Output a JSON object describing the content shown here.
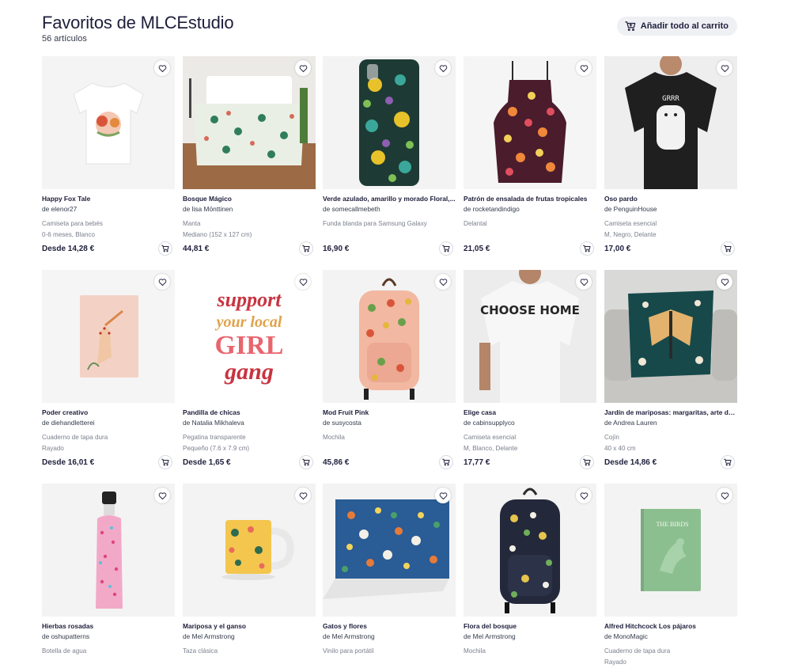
{
  "page": {
    "title": "Favoritos de MLCEstudio",
    "count": "56 artículos",
    "add_all_label": "Añadir todo al carrito",
    "add_all_icon": "cart-icon"
  },
  "products": [
    {
      "name": "Happy Fox Tale",
      "artist": "de elenor27",
      "type": "Camiseta para bebés",
      "variant": "0-6 meses, Blanco",
      "price": "Desde 14,28 €"
    },
    {
      "name": "Bosque Mágico",
      "artist": "de lisa Mönttinen",
      "type": "Manta",
      "variant": "Mediano (152 x 127 cm)",
      "price": "44,81 €"
    },
    {
      "name": "Verde azulado, amarillo y morado Floral,...",
      "artist": "de somecallmebeth",
      "type": "Funda blanda para Samsung Galaxy",
      "variant": "",
      "price": "16,90 €"
    },
    {
      "name": "Patrón de ensalada de frutas tropicales",
      "artist": "de rocketandindigo",
      "type": "Delantal",
      "variant": "",
      "price": "21,05 €"
    },
    {
      "name": "Oso pardo",
      "artist": "de PenguinHouse",
      "type": "Camiseta esencial",
      "variant": "M, Negro, Delante",
      "price": "17,00 €"
    },
    {
      "name": "Poder creativo",
      "artist": "de diehandletterei",
      "type": "Cuaderno de tapa dura",
      "variant": "Rayado",
      "price": "Desde 16,01 €"
    },
    {
      "name": "Pandilla de chicas",
      "artist": "de Natalia Mikhaleva",
      "type": "Pegatina transparente",
      "variant": "Pequeño (7.6 x 7.9 cm)",
      "price": "Desde 1,65 €"
    },
    {
      "name": "Mod Fruit Pink",
      "artist": "de susycosta",
      "type": "Mochila",
      "variant": "",
      "price": "45,86 €"
    },
    {
      "name": "Elige casa",
      "artist": "de cabinsupplyco",
      "type": "Camiseta esencial",
      "variant": "M, Blanco, Delante",
      "price": "17,77 €"
    },
    {
      "name": "Jardín de mariposas: margaritas, arte de...",
      "artist": "de Andrea Lauren",
      "type": "Cojín",
      "variant": "40 x 40 cm",
      "price": "Desde 14,86 €"
    },
    {
      "name": "Hierbas rosadas",
      "artist": "de oshupatterns",
      "type": "Botella de agua",
      "variant": "",
      "price": ""
    },
    {
      "name": "Mariposa y el ganso",
      "artist": "de Mel Armstrong",
      "type": "Taza clásica",
      "variant": "",
      "price": ""
    },
    {
      "name": "Gatos y flores",
      "artist": "de Mel Armstrong",
      "type": "Vinilo para portátil",
      "variant": "",
      "price": ""
    },
    {
      "name": "Flora del bosque",
      "artist": "de Mel Armstrong",
      "type": "Mochila",
      "variant": "",
      "price": ""
    },
    {
      "name": "Alfred Hitchcock Los pájaros",
      "artist": "de MonoMagic",
      "type": "Cuaderno de tapa dura",
      "variant": "Rayado",
      "price": ""
    }
  ],
  "artwork_text": {
    "sticker_lines": [
      "support",
      "your local",
      "GIRL",
      "gang"
    ],
    "shirt_text": "CHOOSE HOME",
    "bear_text": "GRRR",
    "book_title": "THE BIRDS"
  },
  "colors": {
    "text_primary": "#1e1e3c",
    "text_muted": "#7a7f8c",
    "button_bg": "#eef0f4"
  }
}
